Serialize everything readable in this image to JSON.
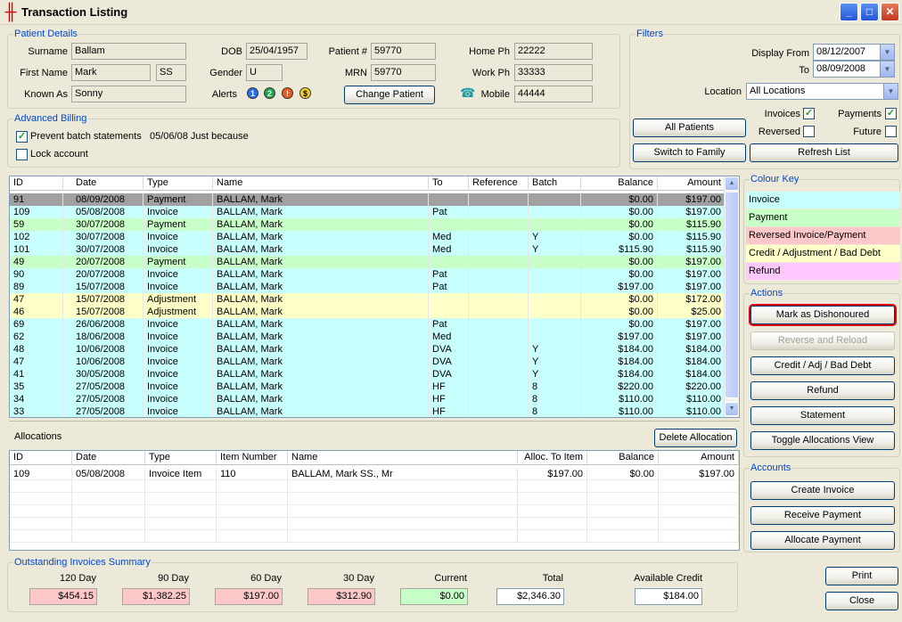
{
  "window": {
    "title": "Transaction Listing"
  },
  "patient": {
    "legend": "Patient Details",
    "surname_label": "Surname",
    "surname": "Ballam",
    "firstname_label": "First Name",
    "firstname": "Mark",
    "initials": "SS",
    "knownas_label": "Known As",
    "knownas": "Sonny",
    "dob_label": "DOB",
    "dob": "25/04/1957",
    "gender_label": "Gender",
    "gender": "U",
    "alerts_label": "Alerts",
    "patientno_label": "Patient #",
    "patientno": "59770",
    "mrn_label": "MRN",
    "mrn": "59770",
    "change_btn": "Change Patient",
    "homeph_label": "Home Ph",
    "homeph": "22222",
    "workph_label": "Work Ph",
    "workph": "33333",
    "mobile_label": "Mobile",
    "mobile": "44444"
  },
  "billing": {
    "legend": "Advanced Billing",
    "prevent_label": "Prevent batch statements",
    "prevent_note": "05/06/08 Just because",
    "lock_label": "Lock account"
  },
  "filters": {
    "legend": "Filters",
    "from_label": "Display From",
    "from": "08/12/2007",
    "to_label": "To",
    "to": "08/09/2008",
    "location_label": "Location",
    "location": "All Locations",
    "all_patients": "All Patients",
    "switch_family": "Switch to Family",
    "invoices": "Invoices",
    "payments": "Payments",
    "reversed": "Reversed",
    "future": "Future",
    "refresh": "Refresh List"
  },
  "transactions": {
    "headers": [
      "ID",
      "Date",
      "Type",
      "Name",
      "To",
      "Reference",
      "Batch",
      "Balance",
      "Amount"
    ],
    "rows": [
      {
        "id": "91",
        "date": "08/09/2008",
        "type": "Payment",
        "name": "BALLAM, Mark",
        "to": "",
        "ref": "",
        "batch": "",
        "balance": "$0.00",
        "amount": "$197.00",
        "color": "#a0a0a0"
      },
      {
        "id": "109",
        "date": "05/08/2008",
        "type": "Invoice",
        "name": "BALLAM, Mark",
        "to": "Pat",
        "ref": "",
        "batch": "",
        "balance": "$0.00",
        "amount": "$197.00",
        "color": "#c8ffff"
      },
      {
        "id": "59",
        "date": "30/07/2008",
        "type": "Payment",
        "name": "BALLAM, Mark",
        "to": "",
        "ref": "",
        "batch": "",
        "balance": "$0.00",
        "amount": "$115.90",
        "color": "#c8ffc8"
      },
      {
        "id": "102",
        "date": "30/07/2008",
        "type": "Invoice",
        "name": "BALLAM, Mark",
        "to": "Med",
        "ref": "",
        "batch": "Y",
        "balance": "$0.00",
        "amount": "$115.90",
        "color": "#c8ffff"
      },
      {
        "id": "101",
        "date": "30/07/2008",
        "type": "Invoice",
        "name": "BALLAM, Mark",
        "to": "Med",
        "ref": "",
        "batch": "Y",
        "balance": "$115.90",
        "amount": "$115.90",
        "color": "#c8ffff"
      },
      {
        "id": "49",
        "date": "20/07/2008",
        "type": "Payment",
        "name": "BALLAM, Mark",
        "to": "",
        "ref": "",
        "batch": "",
        "balance": "$0.00",
        "amount": "$197.00",
        "color": "#c8ffc8"
      },
      {
        "id": "90",
        "date": "20/07/2008",
        "type": "Invoice",
        "name": "BALLAM, Mark",
        "to": "Pat",
        "ref": "",
        "batch": "",
        "balance": "$0.00",
        "amount": "$197.00",
        "color": "#c8ffff"
      },
      {
        "id": "89",
        "date": "15/07/2008",
        "type": "Invoice",
        "name": "BALLAM, Mark",
        "to": "Pat",
        "ref": "",
        "batch": "",
        "balance": "$197.00",
        "amount": "$197.00",
        "color": "#c8ffff"
      },
      {
        "id": "47",
        "date": "15/07/2008",
        "type": "Adjustment",
        "name": "BALLAM, Mark",
        "to": "",
        "ref": "",
        "batch": "",
        "balance": "$0.00",
        "amount": "$172.00",
        "color": "#ffffc8"
      },
      {
        "id": "46",
        "date": "15/07/2008",
        "type": "Adjustment",
        "name": "BALLAM, Mark",
        "to": "",
        "ref": "",
        "batch": "",
        "balance": "$0.00",
        "amount": "$25.00",
        "color": "#ffffc8"
      },
      {
        "id": "69",
        "date": "26/06/2008",
        "type": "Invoice",
        "name": "BALLAM, Mark",
        "to": "Pat",
        "ref": "",
        "batch": "",
        "balance": "$0.00",
        "amount": "$197.00",
        "color": "#c8ffff"
      },
      {
        "id": "62",
        "date": "18/06/2008",
        "type": "Invoice",
        "name": "BALLAM, Mark",
        "to": "Med",
        "ref": "",
        "batch": "",
        "balance": "$197.00",
        "amount": "$197.00",
        "color": "#c8ffff"
      },
      {
        "id": "48",
        "date": "10/06/2008",
        "type": "Invoice",
        "name": "BALLAM, Mark",
        "to": "DVA",
        "ref": "",
        "batch": "Y",
        "balance": "$184.00",
        "amount": "$184.00",
        "color": "#c8ffff"
      },
      {
        "id": "47",
        "date": "10/06/2008",
        "type": "Invoice",
        "name": "BALLAM, Mark",
        "to": "DVA",
        "ref": "",
        "batch": "Y",
        "balance": "$184.00",
        "amount": "$184.00",
        "color": "#c8ffff"
      },
      {
        "id": "41",
        "date": "30/05/2008",
        "type": "Invoice",
        "name": "BALLAM, Mark",
        "to": "DVA",
        "ref": "",
        "batch": "Y",
        "balance": "$184.00",
        "amount": "$184.00",
        "color": "#c8ffff"
      },
      {
        "id": "35",
        "date": "27/05/2008",
        "type": "Invoice",
        "name": "BALLAM, Mark",
        "to": "HF",
        "ref": "",
        "batch": "8",
        "balance": "$220.00",
        "amount": "$220.00",
        "color": "#c8ffff"
      },
      {
        "id": "34",
        "date": "27/05/2008",
        "type": "Invoice",
        "name": "BALLAM, Mark",
        "to": "HF",
        "ref": "",
        "batch": "8",
        "balance": "$110.00",
        "amount": "$110.00",
        "color": "#c8ffff"
      },
      {
        "id": "33",
        "date": "27/05/2008",
        "type": "Invoice",
        "name": "BALLAM, Mark",
        "to": "HF",
        "ref": "",
        "batch": "8",
        "balance": "$110.00",
        "amount": "$110.00",
        "color": "#c8ffff"
      }
    ]
  },
  "colour_key": {
    "legend": "Colour Key",
    "items": [
      {
        "label": "Invoice",
        "color": "#c8ffff"
      },
      {
        "label": "Payment",
        "color": "#c8ffc8"
      },
      {
        "label": "Reversed Invoice/Payment",
        "color": "#ffc8c8"
      },
      {
        "label": "Credit / Adjustment / Bad Debt",
        "color": "#ffffc8"
      },
      {
        "label": "Refund",
        "color": "#ffc8ff"
      }
    ]
  },
  "actions": {
    "legend": "Actions",
    "dishonour": "Mark as Dishonoured",
    "reverse": "Reverse and Reload",
    "credit": "Credit / Adj / Bad Debt",
    "refund": "Refund",
    "statement": "Statement",
    "toggle_alloc": "Toggle Allocations View"
  },
  "accounts": {
    "legend": "Accounts",
    "create_invoice": "Create Invoice",
    "receive_payment": "Receive Payment",
    "allocate_payment": "Allocate Payment"
  },
  "allocations": {
    "title": "Allocations",
    "delete_btn": "Delete Allocation",
    "headers": [
      "ID",
      "Date",
      "Type",
      "Item Number",
      "Name",
      "Alloc. To Item",
      "Balance",
      "Amount"
    ],
    "rows": [
      {
        "id": "109",
        "date": "05/08/2008",
        "type": "Invoice Item",
        "item": "110",
        "name": "BALLAM, Mark SS., Mr",
        "alloc": "$197.00",
        "balance": "$0.00",
        "amount": "$197.00"
      }
    ]
  },
  "summary": {
    "legend": "Outstanding Invoices Summary",
    "d120_label": "120 Day",
    "d120": "$454.15",
    "d90_label": "90 Day",
    "d90": "$1,382.25",
    "d60_label": "60 Day",
    "d60": "$197.00",
    "d30_label": "30 Day",
    "d30": "$312.90",
    "current_label": "Current",
    "current": "$0.00",
    "total_label": "Total",
    "total": "$2,346.30",
    "credit_label": "Available Credit",
    "credit": "$184.00"
  },
  "footer": {
    "print": "Print",
    "close": "Close"
  }
}
